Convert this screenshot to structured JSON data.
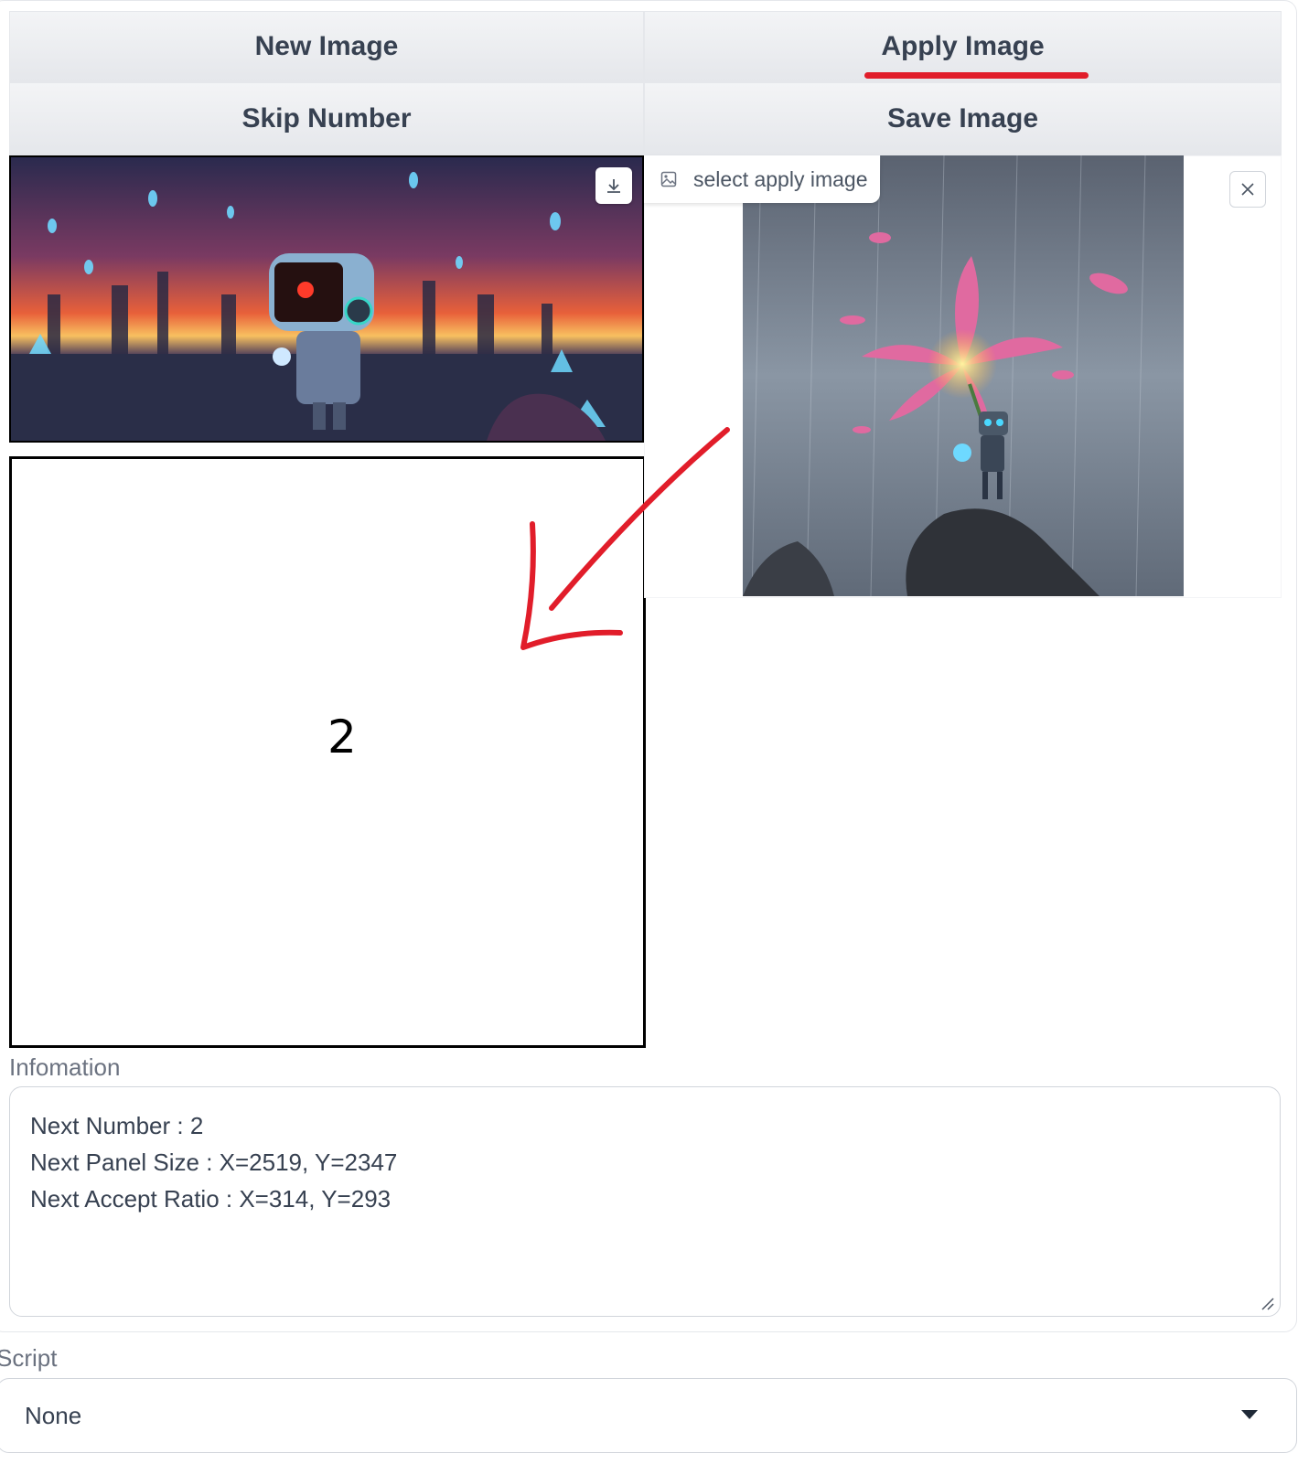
{
  "buttons": {
    "new_image": "New Image",
    "apply_image": "Apply Image",
    "skip_number": "Skip Number",
    "save_image": "Save Image"
  },
  "panel": {
    "number": "2"
  },
  "apply_image_input": {
    "label": "select apply image"
  },
  "information": {
    "label": "Infomation",
    "lines": [
      "Next Number : 2",
      "Next Panel Size : X=2519, Y=2347",
      "Next Accept Ratio : X=314, Y=293"
    ]
  },
  "script": {
    "label": "Script",
    "selected": "None"
  },
  "colors": {
    "annotation_red": "#e11d2a",
    "button_text": "#374151"
  }
}
